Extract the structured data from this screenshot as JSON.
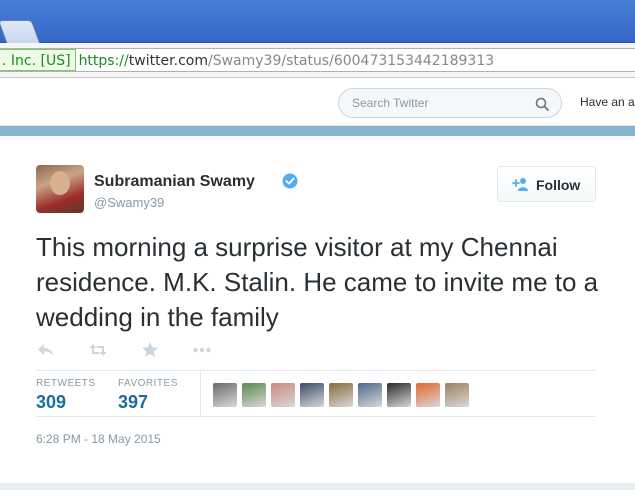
{
  "browser": {
    "ev_label": ". Inc. [US]",
    "url_scheme": "https://",
    "url_host": "twitter.com",
    "url_path": "/Swamy39/status/600473153442189313"
  },
  "header": {
    "search_placeholder": "Search Twitter",
    "account_prompt": "Have an a"
  },
  "tweet": {
    "author_name": "Subramanian Swamy",
    "author_handle": "@Swamy39",
    "follow_label": "Follow",
    "text": "This morning a surprise visitor at my Chennai residence. M.K. Stalin. He came to invite me to a wedding in the family",
    "retweets_label": "RETWEETS",
    "retweets_count": "309",
    "favorites_label": "FAVORITES",
    "favorites_count": "397",
    "timestamp": "6:28 PM - 18 May 2015"
  },
  "colors": {
    "accent_blue": "#1a6e9c",
    "verified_blue": "#55acee",
    "header_band": "#8ab3cf"
  },
  "favoriters": [
    {
      "icon": "favoriter-avatar-1",
      "color": "#6b6b6b"
    },
    {
      "icon": "favoriter-avatar-2",
      "color": "#5a8a4a"
    },
    {
      "icon": "favoriter-avatar-3",
      "color": "#c98a7a"
    },
    {
      "icon": "favoriter-avatar-4",
      "color": "#3a4a6a"
    },
    {
      "icon": "favoriter-avatar-5",
      "color": "#8a6a3a"
    },
    {
      "icon": "favoriter-avatar-6",
      "color": "#4a6a8a"
    },
    {
      "icon": "favoriter-avatar-7",
      "color": "#2a2a2a"
    },
    {
      "icon": "favoriter-avatar-8",
      "color": "#e4662a"
    },
    {
      "icon": "favoriter-avatar-9",
      "color": "#a08060"
    }
  ]
}
